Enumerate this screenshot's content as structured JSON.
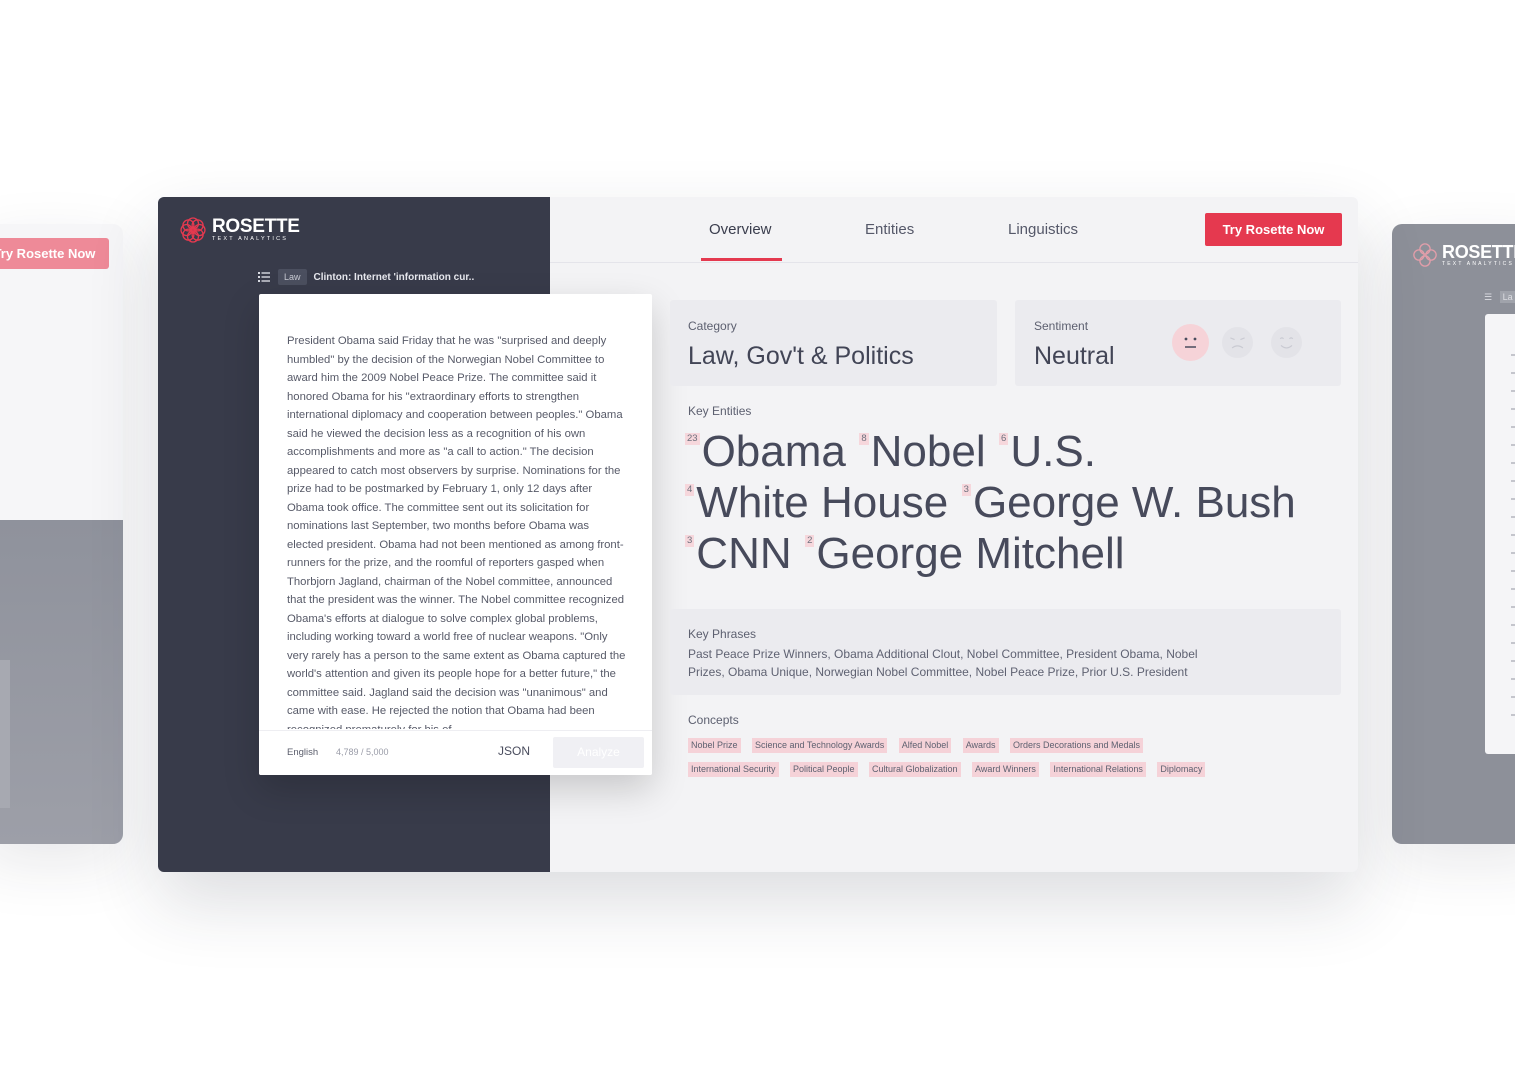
{
  "brand": {
    "name": "ROSETTE",
    "tagline": "TEXT ANALYTICS",
    "accent_color": "#e5394f",
    "sidebar_color": "#383b4a"
  },
  "side_left": {
    "cta_label": "Try Rosette Now"
  },
  "side_right": {
    "crumb_tag": "La"
  },
  "nav": {
    "tabs": [
      "Overview",
      "Entities",
      "Linguistics"
    ],
    "active_tab": "Overview",
    "cta_label": "Try Rosette Now"
  },
  "editor": {
    "tag": "Law",
    "doc_title": "Clinton: Internet 'information cur..",
    "text": "President Obama said Friday that he was \"surprised and deeply humbled\" by the decision of the Norwegian Nobel Committee to award him the 2009 Nobel Peace Prize. The committee said it honored Obama for his \"extraordinary efforts to strengthen international diplomacy and cooperation between peoples.\" Obama said he viewed the decision less as a recognition of his own accomplishments and more as \"a call to action.\" The decision appeared to catch most observers by surprise. Nominations for the prize had to be postmarked by February 1, only 12 days after Obama took office. The committee sent out its solicitation for nominations last September, two months before Obama was elected president. Obama had not been mentioned as among front-runners for the prize, and the roomful of reporters gasped when Thorbjorn Jagland, chairman of the Nobel committee, announced that the president was the winner. The Nobel committee recognized Obama's efforts at dialogue to solve complex global problems, including working toward a world free of nuclear weapons. \"Only very rarely has a person to the same extent as Obama captured the world's attention and given its people hope for a better future,\" the committee said. Jagland said the decision was \"unanimous\" and came with ease. He rejected the notion that Obama had been recognized prematurely for his ef",
    "language": "English",
    "char_count": "4,789 / 5,000",
    "json_label": "JSON",
    "analyze_label": "Analyze"
  },
  "category": {
    "label": "Category",
    "value": "Law, Gov't & Politics"
  },
  "sentiment": {
    "label": "Sentiment",
    "value": "Neutral",
    "faces": [
      "neutral-face-icon",
      "angry-face-icon",
      "happy-face-icon"
    ],
    "active": "neutral-face-icon"
  },
  "key_entities": {
    "label": "Key Entities",
    "rows": [
      [
        {
          "count": "23",
          "name": "Obama"
        },
        {
          "count": "8",
          "name": "Nobel"
        },
        {
          "count": "6",
          "name": "U.S."
        }
      ],
      [
        {
          "count": "4",
          "name": "White House"
        },
        {
          "count": "3",
          "name": "George W. Bush"
        }
      ],
      [
        {
          "count": "3",
          "name": "CNN"
        },
        {
          "count": "2",
          "name": "George Mitchell"
        }
      ]
    ]
  },
  "key_phrases": {
    "label": "Key Phrases",
    "text": "Past Peace Prize Winners, Obama Additional Clout, Nobel Committee, President Obama, Nobel Prizes, Obama Unique, Norwegian Nobel Committee, Nobel Peace Prize, Prior U.S. President"
  },
  "concepts": {
    "label": "Concepts",
    "items": [
      "Nobel Prize",
      "Science and Technology Awards",
      "Alfed Nobel",
      "Awards",
      "Orders Decorations and Medals",
      "International Security",
      "Political People",
      "Cultural Globalization",
      "Award Winners",
      "International Relations",
      "Diplomacy"
    ]
  }
}
